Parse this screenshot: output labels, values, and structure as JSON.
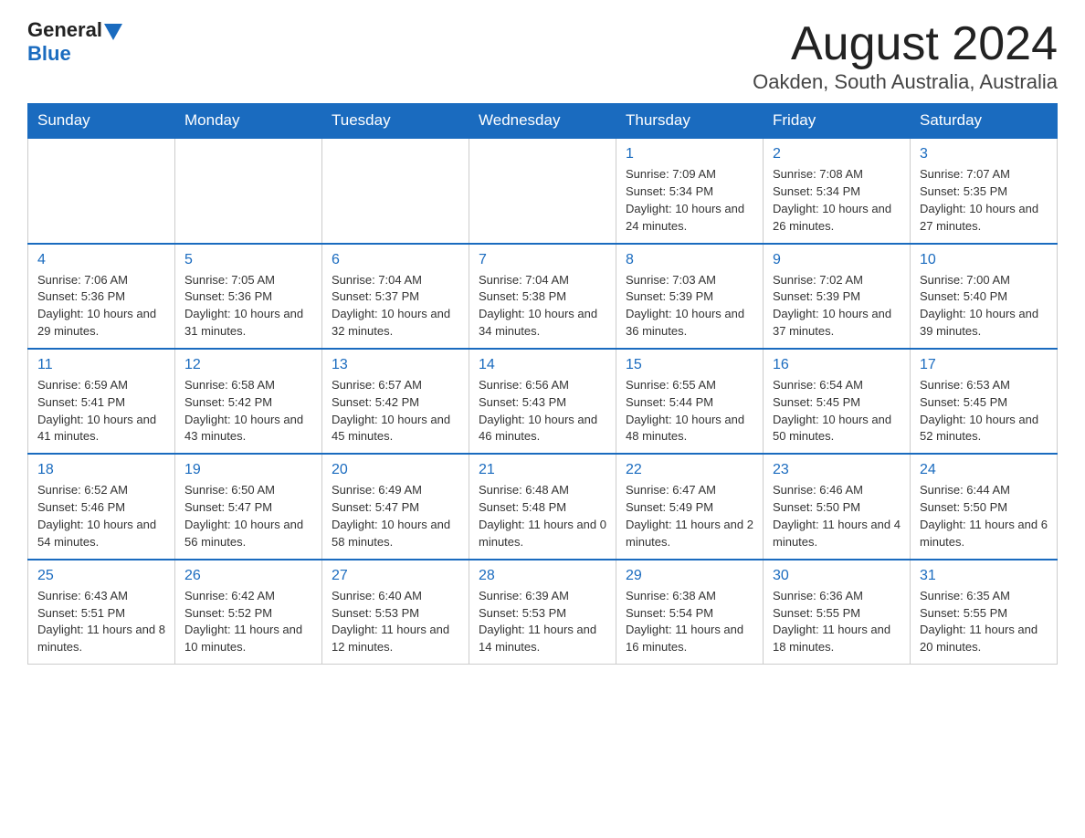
{
  "header": {
    "logo_general": "General",
    "logo_blue": "Blue",
    "month_title": "August 2024",
    "location": "Oakden, South Australia, Australia"
  },
  "days_of_week": [
    "Sunday",
    "Monday",
    "Tuesday",
    "Wednesday",
    "Thursday",
    "Friday",
    "Saturday"
  ],
  "weeks": [
    [
      {
        "day": "",
        "info": ""
      },
      {
        "day": "",
        "info": ""
      },
      {
        "day": "",
        "info": ""
      },
      {
        "day": "",
        "info": ""
      },
      {
        "day": "1",
        "info": "Sunrise: 7:09 AM\nSunset: 5:34 PM\nDaylight: 10 hours and 24 minutes."
      },
      {
        "day": "2",
        "info": "Sunrise: 7:08 AM\nSunset: 5:34 PM\nDaylight: 10 hours and 26 minutes."
      },
      {
        "day": "3",
        "info": "Sunrise: 7:07 AM\nSunset: 5:35 PM\nDaylight: 10 hours and 27 minutes."
      }
    ],
    [
      {
        "day": "4",
        "info": "Sunrise: 7:06 AM\nSunset: 5:36 PM\nDaylight: 10 hours and 29 minutes."
      },
      {
        "day": "5",
        "info": "Sunrise: 7:05 AM\nSunset: 5:36 PM\nDaylight: 10 hours and 31 minutes."
      },
      {
        "day": "6",
        "info": "Sunrise: 7:04 AM\nSunset: 5:37 PM\nDaylight: 10 hours and 32 minutes."
      },
      {
        "day": "7",
        "info": "Sunrise: 7:04 AM\nSunset: 5:38 PM\nDaylight: 10 hours and 34 minutes."
      },
      {
        "day": "8",
        "info": "Sunrise: 7:03 AM\nSunset: 5:39 PM\nDaylight: 10 hours and 36 minutes."
      },
      {
        "day": "9",
        "info": "Sunrise: 7:02 AM\nSunset: 5:39 PM\nDaylight: 10 hours and 37 minutes."
      },
      {
        "day": "10",
        "info": "Sunrise: 7:00 AM\nSunset: 5:40 PM\nDaylight: 10 hours and 39 minutes."
      }
    ],
    [
      {
        "day": "11",
        "info": "Sunrise: 6:59 AM\nSunset: 5:41 PM\nDaylight: 10 hours and 41 minutes."
      },
      {
        "day": "12",
        "info": "Sunrise: 6:58 AM\nSunset: 5:42 PM\nDaylight: 10 hours and 43 minutes."
      },
      {
        "day": "13",
        "info": "Sunrise: 6:57 AM\nSunset: 5:42 PM\nDaylight: 10 hours and 45 minutes."
      },
      {
        "day": "14",
        "info": "Sunrise: 6:56 AM\nSunset: 5:43 PM\nDaylight: 10 hours and 46 minutes."
      },
      {
        "day": "15",
        "info": "Sunrise: 6:55 AM\nSunset: 5:44 PM\nDaylight: 10 hours and 48 minutes."
      },
      {
        "day": "16",
        "info": "Sunrise: 6:54 AM\nSunset: 5:45 PM\nDaylight: 10 hours and 50 minutes."
      },
      {
        "day": "17",
        "info": "Sunrise: 6:53 AM\nSunset: 5:45 PM\nDaylight: 10 hours and 52 minutes."
      }
    ],
    [
      {
        "day": "18",
        "info": "Sunrise: 6:52 AM\nSunset: 5:46 PM\nDaylight: 10 hours and 54 minutes."
      },
      {
        "day": "19",
        "info": "Sunrise: 6:50 AM\nSunset: 5:47 PM\nDaylight: 10 hours and 56 minutes."
      },
      {
        "day": "20",
        "info": "Sunrise: 6:49 AM\nSunset: 5:47 PM\nDaylight: 10 hours and 58 minutes."
      },
      {
        "day": "21",
        "info": "Sunrise: 6:48 AM\nSunset: 5:48 PM\nDaylight: 11 hours and 0 minutes."
      },
      {
        "day": "22",
        "info": "Sunrise: 6:47 AM\nSunset: 5:49 PM\nDaylight: 11 hours and 2 minutes."
      },
      {
        "day": "23",
        "info": "Sunrise: 6:46 AM\nSunset: 5:50 PM\nDaylight: 11 hours and 4 minutes."
      },
      {
        "day": "24",
        "info": "Sunrise: 6:44 AM\nSunset: 5:50 PM\nDaylight: 11 hours and 6 minutes."
      }
    ],
    [
      {
        "day": "25",
        "info": "Sunrise: 6:43 AM\nSunset: 5:51 PM\nDaylight: 11 hours and 8 minutes."
      },
      {
        "day": "26",
        "info": "Sunrise: 6:42 AM\nSunset: 5:52 PM\nDaylight: 11 hours and 10 minutes."
      },
      {
        "day": "27",
        "info": "Sunrise: 6:40 AM\nSunset: 5:53 PM\nDaylight: 11 hours and 12 minutes."
      },
      {
        "day": "28",
        "info": "Sunrise: 6:39 AM\nSunset: 5:53 PM\nDaylight: 11 hours and 14 minutes."
      },
      {
        "day": "29",
        "info": "Sunrise: 6:38 AM\nSunset: 5:54 PM\nDaylight: 11 hours and 16 minutes."
      },
      {
        "day": "30",
        "info": "Sunrise: 6:36 AM\nSunset: 5:55 PM\nDaylight: 11 hours and 18 minutes."
      },
      {
        "day": "31",
        "info": "Sunrise: 6:35 AM\nSunset: 5:55 PM\nDaylight: 11 hours and 20 minutes."
      }
    ]
  ]
}
